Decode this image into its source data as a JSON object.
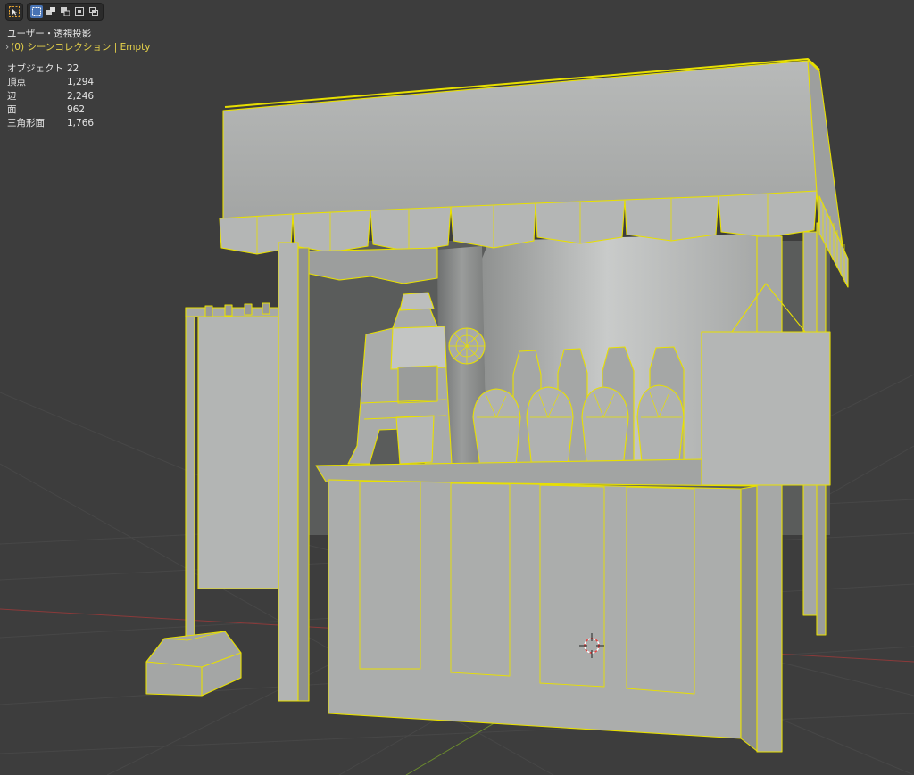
{
  "viewport": {
    "view_label": "ユーザー・透視投影",
    "collection_label": "(0) シーンコレクション | Empty",
    "stats": [
      {
        "key": "オブジェクト",
        "value": "22"
      },
      {
        "key": "頂点",
        "value": "1,294"
      },
      {
        "key": "辺",
        "value": "2,246"
      },
      {
        "key": "面",
        "value": "962"
      },
      {
        "key": "三角形面",
        "value": "1,766"
      }
    ]
  },
  "toolbar": {
    "select_tool_icon": "cursor-arrow-icon",
    "select_modes": [
      "select-new-icon",
      "select-extend-icon",
      "select-subtract-icon",
      "select-invert-icon",
      "select-intersect-icon"
    ]
  },
  "colors": {
    "background": "#3d3d3d",
    "grid": "#474747",
    "axis_x": "#8b3a3a",
    "axis_y": "#6b8b2e",
    "selection_outline": "#e8e000",
    "model_fill": "#a9abaa",
    "active_mode": "#4772b3"
  }
}
